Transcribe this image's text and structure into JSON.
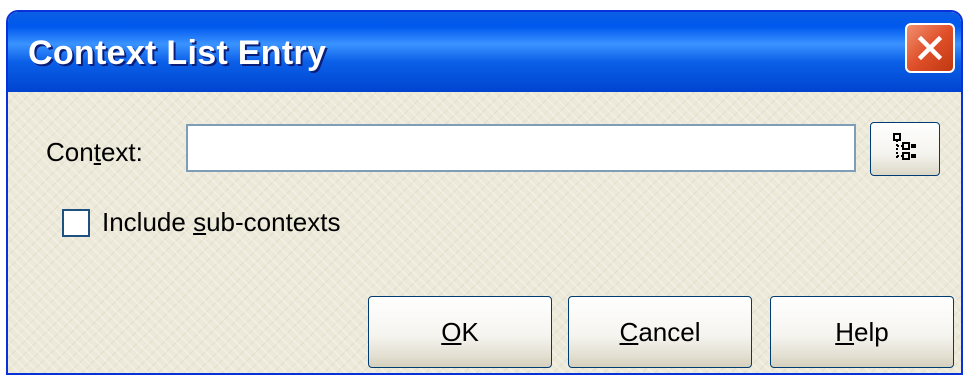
{
  "window": {
    "title": "Context List Entry",
    "close_icon": "close-icon",
    "title_bar_color": "#0058ee",
    "close_button_color": "#e0502a",
    "body_color": "#ece9d8"
  },
  "context": {
    "label_prefix": "Con",
    "label_mnemonic": "t",
    "label_suffix": "ext:",
    "value": "",
    "browse_icon": "tree-list-icon"
  },
  "include_sub_contexts": {
    "checked": false,
    "label_prefix": "Include ",
    "label_mnemonic": "s",
    "label_suffix": "ub-contexts"
  },
  "buttons": {
    "ok": {
      "mnemonic": "O",
      "rest": "K"
    },
    "cancel": {
      "mnemonic": "C",
      "rest": "ancel"
    },
    "help": {
      "mnemonic": "H",
      "rest": "elp"
    }
  }
}
